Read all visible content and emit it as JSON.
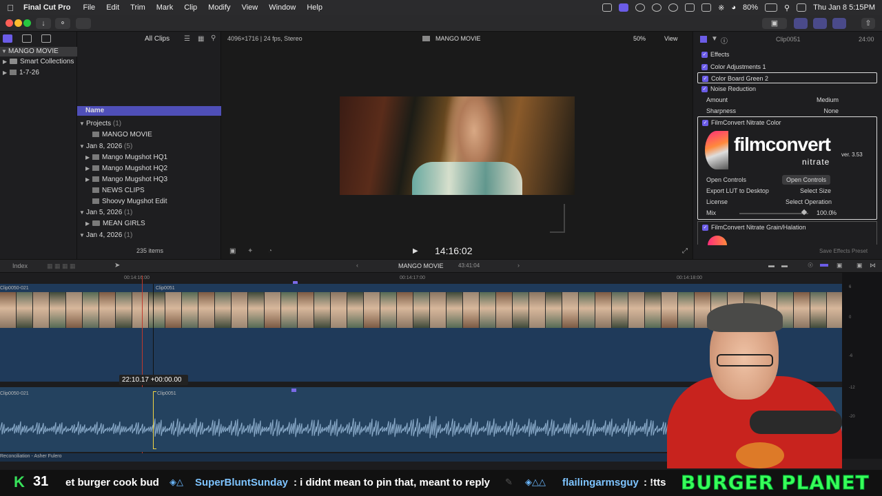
{
  "menubar": {
    "app_name": "Final Cut Pro",
    "menus": [
      "File",
      "Edit",
      "Trim",
      "Mark",
      "Clip",
      "Modify",
      "View",
      "Window",
      "Help"
    ],
    "battery": "80%",
    "datetime": "Thu Jan 8  5:15PM"
  },
  "library": {
    "name": "MANGO MOVIE",
    "items": [
      "Smart Collections",
      "1-7-26"
    ]
  },
  "browser": {
    "filter": "All Clips",
    "column_header": "Name",
    "groups": [
      {
        "label": "Projects",
        "count": "(1)",
        "items": [
          "MANGO MOVIE"
        ]
      },
      {
        "label": "Jan 8, 2026",
        "count": "(5)",
        "items": [
          "Mango Mugshot HQ1",
          "Mango Mugshot HQ2",
          "Mango Mugshot HQ3",
          "NEWS CLIPS",
          "Shoovy Mugshot Edit"
        ]
      },
      {
        "label": "Jan 5, 2026",
        "count": "(1)",
        "items": [
          "MEAN GIRLS"
        ]
      },
      {
        "label": "Jan 4, 2026",
        "count": "(1)",
        "items": []
      }
    ],
    "item_count": "235 items"
  },
  "viewer": {
    "format": "4096×1716 | 24 fps, Stereo",
    "title": "MANGO MOVIE",
    "zoom": "50%",
    "view_label": "View",
    "timecode": "14:16:02"
  },
  "inspector": {
    "clip_name": "Clip0051",
    "duration": "24:00",
    "section": "Effects",
    "effects": [
      "Color Adjustments 1",
      "Color Board Green 2",
      "Noise Reduction"
    ],
    "amount_label": "Amount",
    "amount_value": "Medium",
    "sharpness_label": "Sharpness",
    "sharpness_value": "None",
    "filmconvert_label": "FilmConvert Nitrate Color",
    "logo_main": "filmconvert",
    "logo_sub": "nitrate",
    "version": "ver. 3.53",
    "open_controls_label": "Open Controls",
    "open_controls_button": "Open Controls",
    "export_lut_label": "Export LUT to Desktop",
    "export_lut_value": "Select Size",
    "license_label": "License",
    "license_value": "Select Operation",
    "mix_label": "Mix",
    "mix_value": "100.0",
    "mix_unit": "%",
    "grain_label": "FilmConvert Nitrate Grain/Halation",
    "save_preset": "Save Effects Preset"
  },
  "timeline": {
    "index_label": "Index",
    "project": "MANGO MOVIE",
    "duration": "43:41:04",
    "ruler": [
      "00:14:16:00",
      "00:14:17:00",
      "00:14:18:00"
    ],
    "clip_a": "Clip0050-021",
    "clip_b": "Clip0051",
    "audio_clip_a": "Clip0050-021",
    "audio_clip_b": "Clip0051",
    "trim_readout": "22:10.17  +00:00.00",
    "music_label": "Reconciliation - Asher Fulero",
    "meter_ticks": [
      "6",
      "0",
      "-6",
      "-12",
      "-20"
    ]
  },
  "banner": {
    "badge": "K",
    "badge_count": "31",
    "ticker": "et burger cook bud",
    "user1": "SuperBluntSunday",
    "msg1": ": i didnt mean to pin that, meant to reply",
    "user2": "flailingarmsguy",
    "msg2": ": !tts",
    "logo": "BURGER PLANET"
  },
  "colors": {
    "accent": "#6b5ce7",
    "selection": "#4f4fb8",
    "timeline_blue": "#1f3a5a"
  }
}
